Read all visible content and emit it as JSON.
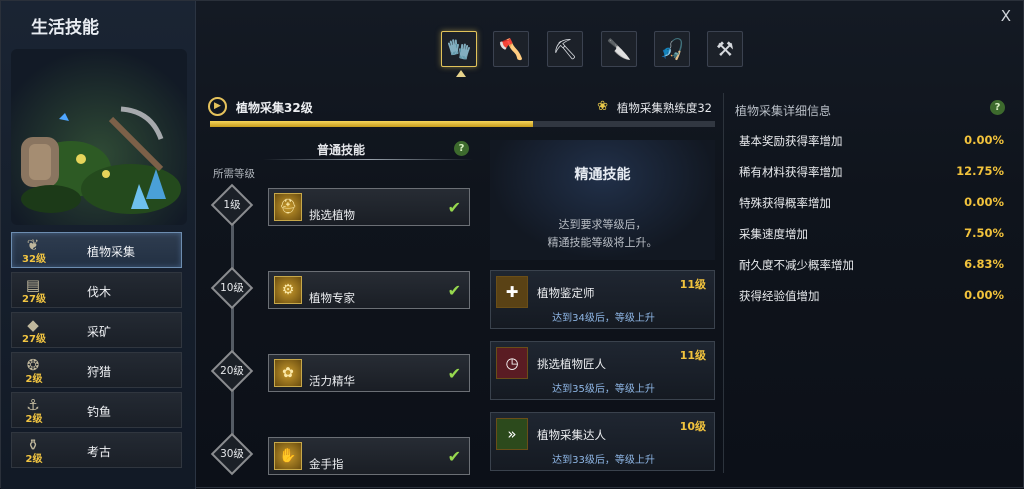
{
  "window": {
    "title": "生活技能",
    "close": "X"
  },
  "sidebar": {
    "items": [
      {
        "level": "32级",
        "label": "植物采集",
        "icon": "sprout-icon"
      },
      {
        "level": "27级",
        "label": "伐木",
        "icon": "log-icon"
      },
      {
        "level": "27级",
        "label": "采矿",
        "icon": "ore-icon"
      },
      {
        "level": "2级",
        "label": "狩猎",
        "icon": "paw-icon"
      },
      {
        "level": "2级",
        "label": "钓鱼",
        "icon": "fishhook-icon"
      },
      {
        "level": "2级",
        "label": "考古",
        "icon": "relic-icon"
      }
    ]
  },
  "tool_tabs": [
    "gloves-icon",
    "axe-icon",
    "pickaxe-icon",
    "knife-icon",
    "fishing-rod-icon",
    "shovel-icon"
  ],
  "header": {
    "skill_title": "植物采集32级",
    "proficiency": "植物采集熟练度32",
    "progress": 0.64
  },
  "normal": {
    "title": "普通技能",
    "help": "?",
    "required_level_label": "所需等级",
    "skills": [
      {
        "level": "1级",
        "name": "挑选植物",
        "icon": "helmet-icon",
        "check": "✔"
      },
      {
        "level": "10级",
        "name": "植物专家",
        "icon": "gears-icon",
        "check": "✔"
      },
      {
        "level": "20级",
        "name": "活力精华",
        "icon": "flower-icon",
        "check": "✔"
      },
      {
        "level": "30级",
        "name": "金手指",
        "icon": "hand-icon",
        "check": "✔"
      }
    ]
  },
  "mastery": {
    "title": "精通技能",
    "desc_line1": "达到要求等级后，",
    "desc_line2": "精通技能等级将上升。",
    "skills": [
      {
        "name": "植物鉴定师",
        "level": "11级",
        "condition": "达到34级后，等级上升",
        "icon": "herb-plus-icon",
        "color": "#5a4215"
      },
      {
        "name": "挑选植物匠人",
        "level": "11级",
        "condition": "达到35级后，等级上升",
        "icon": "hand-clock-icon",
        "color": "#5a1c23"
      },
      {
        "name": "植物采集达人",
        "level": "10级",
        "condition": "达到33级后，等级上升",
        "icon": "herb-arrow-icon",
        "color": "#2c4a1c"
      }
    ]
  },
  "details": {
    "title": "植物采集详细信息",
    "help": "?",
    "rows": [
      {
        "label": "基本奖励获得率增加",
        "value": "0.00%"
      },
      {
        "label": "稀有材料获得率增加",
        "value": "12.75%"
      },
      {
        "label": "特殊获得概率增加",
        "value": "0.00%"
      },
      {
        "label": "采集速度增加",
        "value": "7.50%"
      },
      {
        "label": "耐久度不减少概率增加",
        "value": "6.83%"
      },
      {
        "label": "获得经验值增加",
        "value": "0.00%"
      }
    ]
  }
}
